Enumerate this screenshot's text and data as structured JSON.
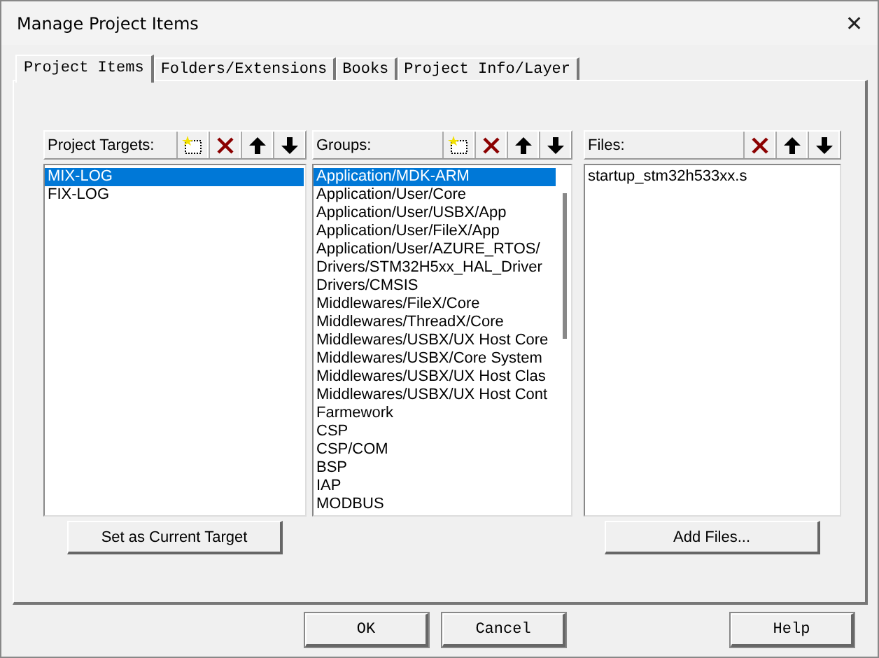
{
  "window": {
    "title": "Manage Project Items",
    "close": "✕"
  },
  "tabs": [
    {
      "label": "Project Items",
      "selected": true
    },
    {
      "label": "Folders/Extensions",
      "selected": false
    },
    {
      "label": "Books",
      "selected": false
    },
    {
      "label": "Project Info/Layer",
      "selected": false
    }
  ],
  "panels": [
    {
      "label": "Project Targets:",
      "tools": [
        {
          "kind": "new"
        },
        {
          "kind": "delete"
        },
        {
          "kind": "up"
        },
        {
          "kind": "down"
        }
      ],
      "items": [
        {
          "text": "MIX-LOG",
          "selected": true
        },
        {
          "text": "FIX-LOG",
          "selected": false
        }
      ],
      "button": "Set as Current Target"
    },
    {
      "label": "Groups:",
      "tools": [
        {
          "kind": "new"
        },
        {
          "kind": "delete"
        },
        {
          "kind": "up"
        },
        {
          "kind": "down"
        }
      ],
      "items": [
        {
          "text": "Application/MDK-ARM",
          "selected": true
        },
        {
          "text": "Application/User/Core",
          "selected": false
        },
        {
          "text": "Application/User/USBX/App",
          "selected": false
        },
        {
          "text": "Application/User/FileX/App",
          "selected": false
        },
        {
          "text": "Application/User/AZURE_RTOS/",
          "selected": false
        },
        {
          "text": "Drivers/STM32H5xx_HAL_Driver",
          "selected": false
        },
        {
          "text": "Drivers/CMSIS",
          "selected": false
        },
        {
          "text": "Middlewares/FileX/Core",
          "selected": false
        },
        {
          "text": "Middlewares/ThreadX/Core",
          "selected": false
        },
        {
          "text": "Middlewares/USBX/UX Host Core",
          "selected": false
        },
        {
          "text": "Middlewares/USBX/Core System",
          "selected": false
        },
        {
          "text": "Middlewares/USBX/UX Host Clas",
          "selected": false
        },
        {
          "text": "Middlewares/USBX/UX Host Cont",
          "selected": false
        },
        {
          "text": "Farmework",
          "selected": false
        },
        {
          "text": "CSP",
          "selected": false
        },
        {
          "text": "CSP/COM",
          "selected": false
        },
        {
          "text": "BSP",
          "selected": false
        },
        {
          "text": "IAP",
          "selected": false
        },
        {
          "text": "MODBUS",
          "selected": false
        }
      ]
    },
    {
      "label": "Files:",
      "tools": [
        {
          "kind": "delete"
        },
        {
          "kind": "up"
        },
        {
          "kind": "down"
        }
      ],
      "items": [
        {
          "text": "startup_stm32h533xx.s",
          "selected": false
        }
      ],
      "button": "Add Files..."
    }
  ],
  "buttons": [
    {
      "label": "OK",
      "kind": "ok"
    },
    {
      "label": "Cancel",
      "kind": "cancel"
    },
    {
      "label": "Help",
      "kind": "help"
    }
  ]
}
